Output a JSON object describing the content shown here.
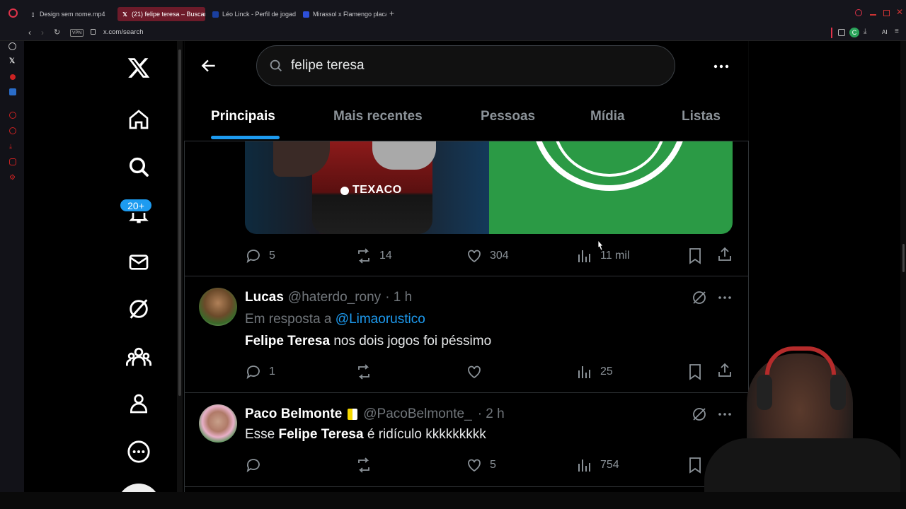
{
  "browser": {
    "tabs": [
      {
        "label": "Design sem nome.mp4"
      },
      {
        "label": "(21) felipe teresa – Buscar"
      },
      {
        "label": "Léo Linck - Perfil de jogad"
      },
      {
        "label": "Mirassol x Flamengo placa"
      }
    ],
    "new_tab": "+",
    "vpn_badge": "VPN",
    "url": "x.com/search",
    "ai_label": "AI",
    "profile_initial": "C"
  },
  "sidebar": {
    "notifications_badge": "20+"
  },
  "search": {
    "query": "felipe teresa"
  },
  "tabs": [
    {
      "label": "Principais"
    },
    {
      "label": "Mais recentes"
    },
    {
      "label": "Pessoas"
    },
    {
      "label": "Mídia"
    },
    {
      "label": "Listas"
    }
  ],
  "media_post": {
    "jersey_text": "TEXACO",
    "replies": "5",
    "reposts": "14",
    "likes": "304",
    "views": "11 mil"
  },
  "posts": [
    {
      "name": "Lucas",
      "handle": "@haterdo_rony",
      "time": "· 1 h",
      "reply_prefix": "Em resposta a",
      "reply_to": "@Limaorustico",
      "text_bold": "Felipe Teresa",
      "text_rest": " nos dois jogos foi péssimo",
      "replies": "1",
      "reposts": "",
      "likes": "",
      "views": "25"
    },
    {
      "name": "Paco Belmonte",
      "handle": "@PacoBelmonte_",
      "time": "· 2 h",
      "text_pre": "Esse ",
      "text_bold": "Felipe Teresa",
      "text_rest": " é ridículo kkkkkkkkk",
      "replies": "",
      "reposts": "",
      "likes": "5",
      "views": "754"
    }
  ],
  "colors": {
    "accent": "#1d9bf0",
    "badge_bg": "#1d9bf0",
    "divider": "#2f3336",
    "muted": "#71767b",
    "active_tab": "#6d1b2a"
  }
}
